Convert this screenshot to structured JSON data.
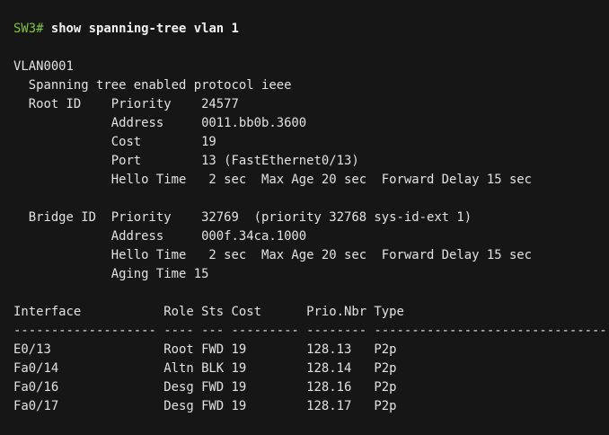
{
  "prompt": "SW3#",
  "command": "show spanning-tree vlan 1",
  "vlan": "VLAN0001",
  "output_lines": [
    "  Spanning tree enabled protocol ieee",
    "  Root ID    Priority    24577",
    "             Address     0011.bb0b.3600",
    "             Cost        19",
    "             Port        13 (FastEthernet0/13)",
    "             Hello Time   2 sec  Max Age 20 sec  Forward Delay 15 sec",
    "",
    "  Bridge ID  Priority    32769  (priority 32768 sys-id-ext 1)",
    "             Address     000f.34ca.1000",
    "             Hello Time   2 sec  Max Age 20 sec  Forward Delay 15 sec",
    "             Aging Time 15",
    ""
  ],
  "table": {
    "header": "Interface           Role Sts Cost      Prio.Nbr Type",
    "separator": "------------------- ---- --- --------- -------- --------------------------------",
    "rows": [
      "E0/13               Root FWD 19        128.13   P2p",
      "Fa0/14              Altn BLK 19        128.14   P2p",
      "Fa0/16              Desg FWD 19        128.16   P2p",
      "Fa0/17              Desg FWD 19        128.17   P2p"
    ]
  }
}
